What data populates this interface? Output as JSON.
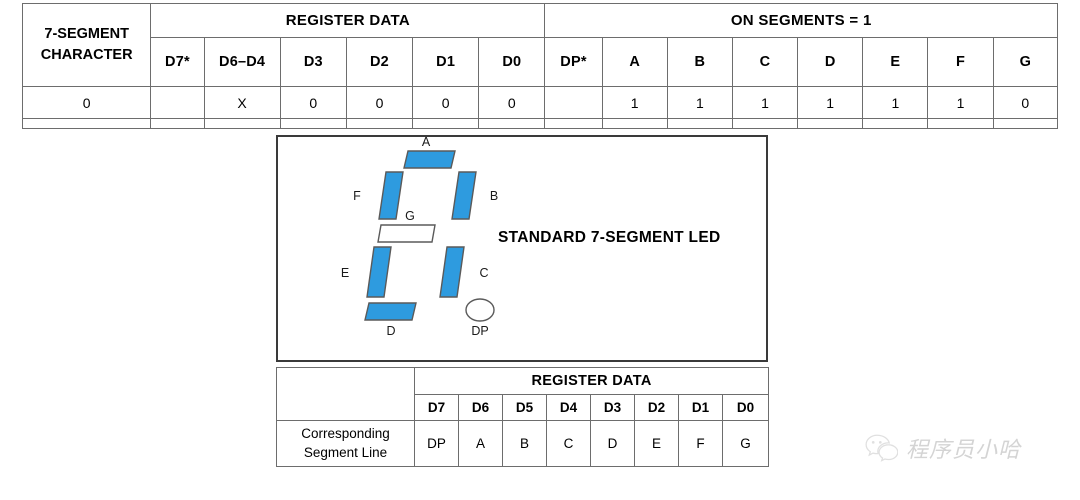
{
  "top_table": {
    "group_headers": [
      {
        "label": "REGISTER DATA",
        "span": 6
      },
      {
        "label": "ON SEGMENTS = 1",
        "span": 7
      }
    ],
    "row_title": "7-SEGMENT\nCHARACTER",
    "row_title_line1": "7-SEGMENT",
    "row_title_line2": "CHARACTER",
    "column_headers": [
      "D7*",
      "D6–D4",
      "D3",
      "D2",
      "D1",
      "D0",
      "DP*",
      "A",
      "B",
      "C",
      "D",
      "E",
      "F",
      "G"
    ],
    "rows": [
      {
        "character": "0",
        "values": [
          "",
          "X",
          "0",
          "0",
          "0",
          "0",
          "",
          "1",
          "1",
          "1",
          "1",
          "1",
          "1",
          "0"
        ]
      }
    ]
  },
  "led_diagram": {
    "caption": "STANDARD 7-SEGMENT LED",
    "segment_labels": {
      "a": "A",
      "b": "B",
      "c": "C",
      "d": "D",
      "e": "E",
      "f": "F",
      "g": "G",
      "dp": "DP"
    },
    "segment_states": {
      "a": "on",
      "b": "on",
      "c": "on",
      "d": "on",
      "e": "on",
      "f": "on",
      "g": "off",
      "dp": "off"
    },
    "colors": {
      "segment_on": "#2E9BDF",
      "segment_off": "#ffffff",
      "segment_outline": "#5a5a5a",
      "box_border": "#3a3a3a"
    }
  },
  "bottom_table": {
    "group_header": "REGISTER DATA",
    "column_headers": [
      "D7",
      "D6",
      "D5",
      "D4",
      "D3",
      "D2",
      "D1",
      "D0"
    ],
    "row_label_line1": "Corresponding",
    "row_label_line2": "Segment Line",
    "segment_lines": [
      "DP",
      "A",
      "B",
      "C",
      "D",
      "E",
      "F",
      "G"
    ]
  },
  "watermark": {
    "text": "程序员小哈",
    "icon": "wechat-icon"
  }
}
